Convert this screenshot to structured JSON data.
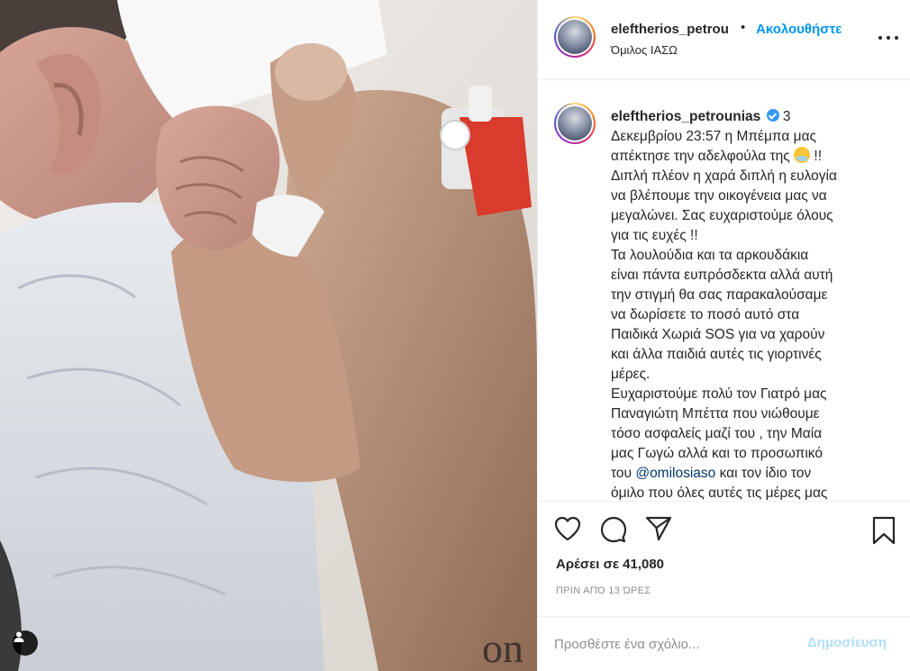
{
  "header": {
    "username": "eleftherios_petrou",
    "separator": "•",
    "follow_label": "Ακολουθήστε",
    "location": "Όμιλος ΙΑΣΩ",
    "more_icon": "more-horizontal-icon"
  },
  "caption": {
    "username": "eleftherios_petrounias",
    "verified_icon": "verified-badge-icon",
    "lines": [
      "3",
      "Δεκεμβρίου 23:57 η Μπέμπα μας",
      "απέκτησε την αδελφούλα της",
      "Διπλή πλέον η χαρά διπλή η ευλογία",
      "να βλέπουμε την οικογένεια μας να",
      "μεγαλώνει. Σας ευχαριστούμε όλους",
      "για τις ευχές !!",
      "Τα λουλούδια και τα αρκουδάκια",
      "είναι πάντα ευπρόσδεκτα αλλά αυτή",
      "την στιγμή θα σας παρακαλούσαμε",
      "να δωρίσετε το ποσό αυτό στα",
      "Παιδικά Χωριά SOS για να χαρούν",
      "και άλλα παιδιά αυτές τις γιορτινές",
      "μέρες.",
      "Ευχαριστούμε πολύ τον Γιατρό μας",
      "Παναγιώτη Μπέττα που νιώθουμε",
      "τόσο ασφαλείς μαζί του , την Μαία",
      "μας Γωγώ αλλά και το προσωπικό",
      "του",
      "και τον ίδιο τον",
      "όμιλο που όλες αυτές τις μέρες μας"
    ],
    "emoji_after_line_2": "baby-emoji",
    "exclaim_after_emoji": "!!",
    "mention": "@omilosiaso"
  },
  "actions": {
    "like_icon": "heart-icon",
    "comment_icon": "comment-icon",
    "share_icon": "share-icon",
    "save_icon": "bookmark-icon"
  },
  "likes_text": "Αρέσει σε 41,080",
  "time_ago": "ΠΡΙΝ ΑΠΌ 13 ΏΡΕΣ",
  "comment": {
    "placeholder": "Προσθέστε ένα σχόλιο...",
    "post_label": "Δημοσίευση"
  },
  "colors": {
    "accent": "#0095f6",
    "post_disabled": "#b2dffc",
    "muted": "#8e8e8e",
    "text": "#262626",
    "mention": "#00376b"
  }
}
